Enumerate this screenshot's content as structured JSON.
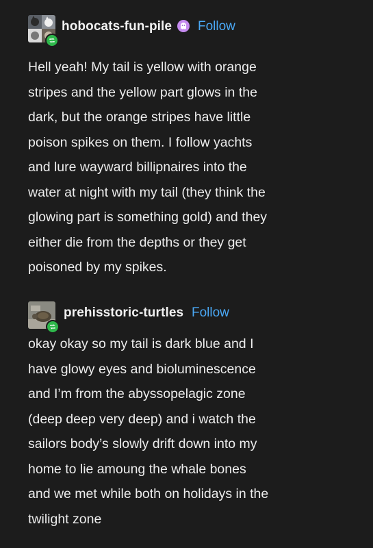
{
  "posts": [
    {
      "username": "hobocats-fun-pile",
      "follow_label": "Follow",
      "avatar_icon": "cat-collage-avatar",
      "badge_icon": "reblog-icon",
      "extra_icon": "ghost-icon",
      "text": "Hell yeah! My tail is yellow with orange\nstripes and the yellow part glows in the\ndark, but the orange stripes have little\npoison spikes on them. I follow yachts\nand lure wayward billipnaires into the\nwater at night with my tail (they think the\nglowing part is something gold) and they\neither die from the depths or they get\npoisoned by my spikes."
    },
    {
      "username": "prehisstoric-turtles",
      "follow_label": "Follow",
      "avatar_icon": "turtle-avatar",
      "badge_icon": "reblog-icon",
      "text": "okay okay so my tail is dark blue and I\nhave glowy eyes and bioluminescence\nand I’m from the abyssopelagic zone\n(deep deep very deep) and i watch the\nsailors body’s slowly drift down into my\nhome to lie amoung the whale bones\nand we met while both on holidays in the\ntwilight zone"
    }
  ],
  "colors": {
    "background": "#1c1c1c",
    "text": "#ececec",
    "follow": "#4aa8f5",
    "badge": "#2eb84b"
  }
}
